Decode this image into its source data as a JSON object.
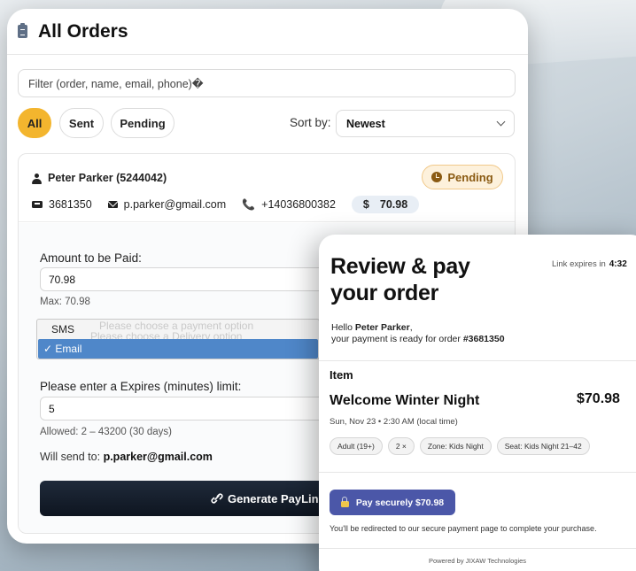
{
  "orders_panel": {
    "title": "All Orders",
    "filter_placeholder": "Filter (order, name, email, phone)�",
    "chips": [
      "All",
      "Sent",
      "Pending"
    ],
    "sort_label": "Sort by:",
    "sort_value": "Newest"
  },
  "order": {
    "customer": "Peter Parker (5244042)",
    "status": "Pending",
    "order_number": "3681350",
    "email": "p.parker@gmail.com",
    "phone": "+14036800382",
    "currency_symbol": "$",
    "amount": "70.98"
  },
  "pay_form": {
    "amount_label": "Amount to be Paid:",
    "amount_value": "70.98",
    "max_hint": "Max: 70.98",
    "delivery_options": [
      "SMS",
      "Email"
    ],
    "delivery_selected": "Email",
    "selected_check": "✓",
    "ghost_text_1": "Please choose a payment option",
    "ghost_text_2": "Please choose a Delivery option",
    "expires_label": "Please enter a Expires (minutes) limit:",
    "expires_value": "5",
    "allowed_hint": "Allowed: 2 – 43200 (30 days)",
    "send_to_prefix": "Will send to:",
    "send_to_value": "p.parker@gmail.com",
    "generate_label": "Generate PayLink"
  },
  "review": {
    "title": "Review & pay your order",
    "expires_label": "Link expires in",
    "expires_value": "4:32",
    "hello": "Hello",
    "name": "Peter Parker",
    "ready_text": "your payment is ready for order",
    "order_ref": "#3681350",
    "item_heading": "Item",
    "event_name": "Welcome Winter Night",
    "event_price": "$70.98",
    "event_date": "Sun, Nov 23 • 2:30 AM (local time)",
    "tags": [
      "Adult (19+)",
      "2 ×",
      "Zone: Kids Night",
      "Seat: Kids Night 21–42"
    ],
    "pay_button": "Pay securely $70.98",
    "redirect_note": "You'll be redirected to our secure payment page to complete your purchase.",
    "powered_by": "Powered by JIXAW Technologies"
  },
  "icons": [
    "clipboard-icon",
    "person-icon",
    "clock-icon",
    "ticket-icon",
    "mail-icon",
    "phone-icon",
    "link-icon",
    "lock-icon",
    "chevron-down-icon"
  ],
  "colors": {
    "accent": "#f3b52e",
    "pending_bg": "#fdf1dc",
    "pay_button": "#4b57a8",
    "generate_button": "#0e1520"
  }
}
